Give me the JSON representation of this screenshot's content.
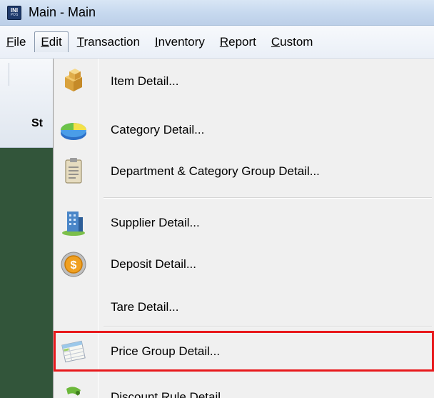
{
  "window": {
    "title": "Main - Main"
  },
  "menubar": {
    "items": [
      {
        "acc": "F",
        "rest": "ile"
      },
      {
        "acc": "E",
        "rest": "dit"
      },
      {
        "acc": "T",
        "rest": "ransaction"
      },
      {
        "acc": "I",
        "rest": "nventory"
      },
      {
        "acc": "R",
        "rest": "eport"
      },
      {
        "acc": "C",
        "rest": "ustom"
      }
    ]
  },
  "toolbar": {
    "partial_label": "St"
  },
  "edit_menu": {
    "items": [
      {
        "label": "Item Detail...",
        "icon": "boxes-icon"
      },
      {
        "label": "Category Detail...",
        "icon": "pie-chart-icon"
      },
      {
        "label": "Department & Category Group Detail...",
        "icon": "clipboard-icon"
      },
      {
        "label": "Supplier Detail...",
        "icon": "building-icon"
      },
      {
        "label": "Deposit Detail...",
        "icon": "coin-icon"
      },
      {
        "label": "Tare Detail...",
        "icon": ""
      },
      {
        "label": "Price Group Detail...",
        "icon": "spreadsheet-icon"
      },
      {
        "label": "Discount Rule Detail...",
        "icon": "discount-icon"
      }
    ],
    "highlighted_item": "Price Group Detail...",
    "highlight_color": "#e8191c"
  }
}
